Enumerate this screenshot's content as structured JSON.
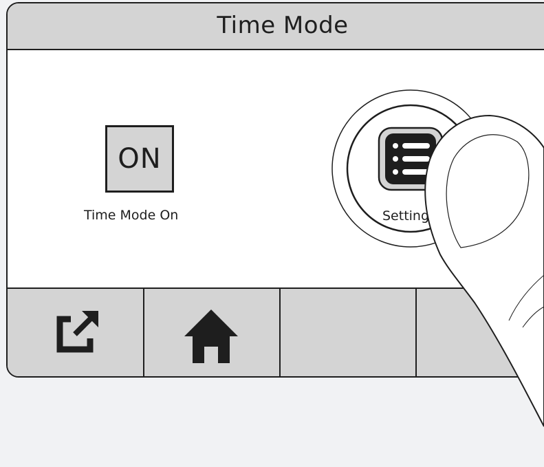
{
  "header": {
    "title": "Time Mode"
  },
  "main": {
    "time_mode_button": {
      "label": "ON",
      "caption": "Time Mode On"
    },
    "settings_button": {
      "caption": "Settings",
      "icon": "settings-list-icon"
    }
  },
  "toolbar": {
    "buttons": [
      {
        "icon": "external-link-icon"
      },
      {
        "icon": "home-icon"
      },
      {
        "icon": ""
      },
      {
        "icon": ""
      }
    ]
  },
  "colors": {
    "panel_gray": "#d4d4d4",
    "line": "#1e1e1e",
    "background": "#f1f2f4",
    "screen": "#ffffff"
  }
}
